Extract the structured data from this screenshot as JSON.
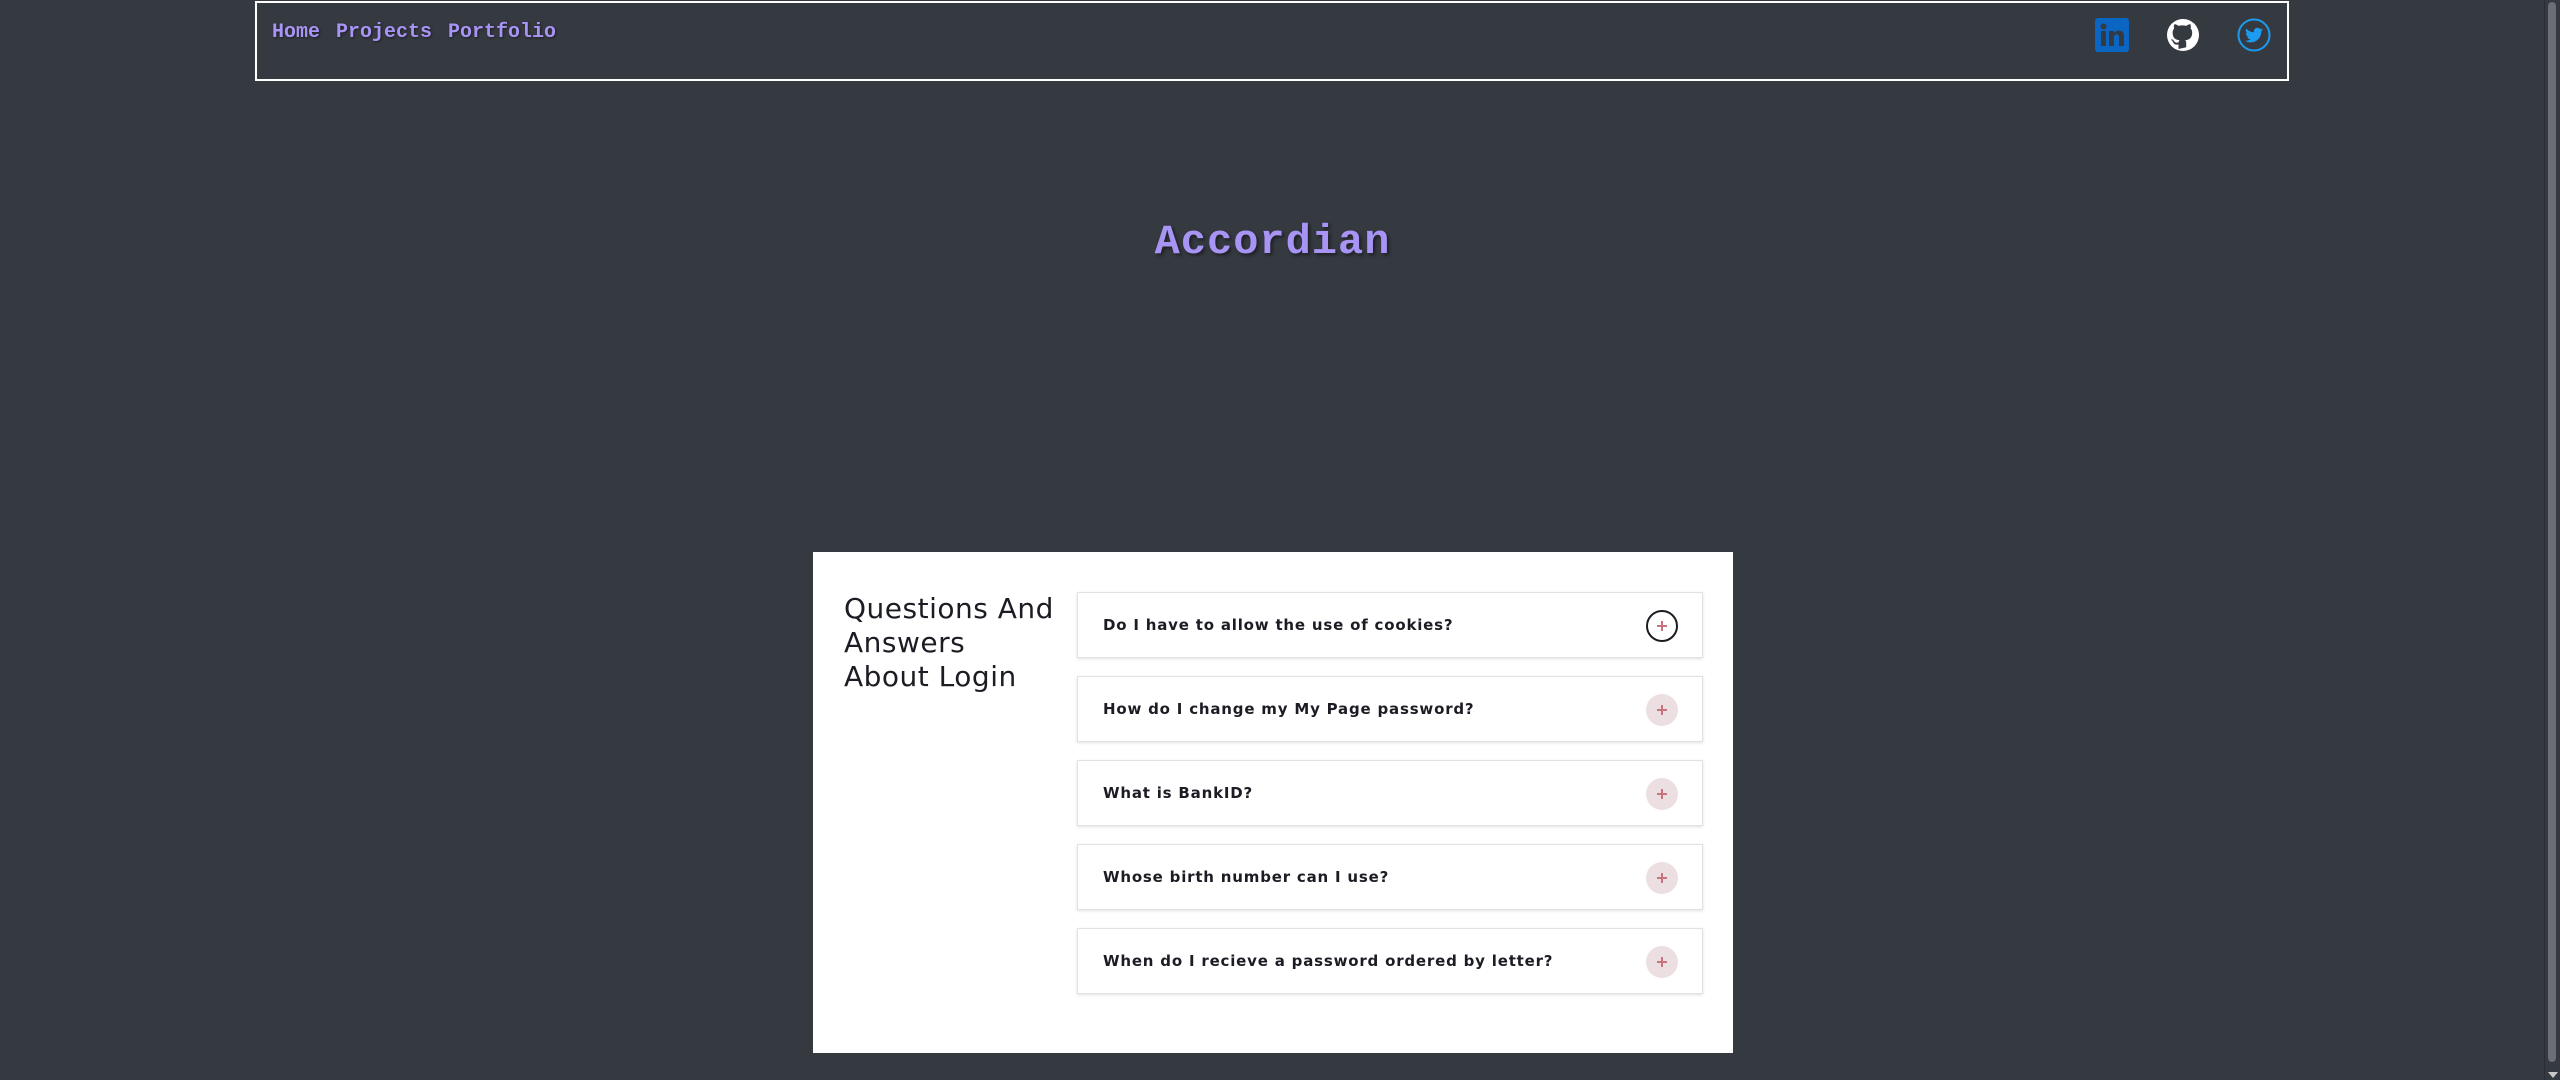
{
  "nav": {
    "links": [
      {
        "label": "Home"
      },
      {
        "label": "Projects"
      },
      {
        "label": "Portfolio"
      }
    ],
    "social": [
      {
        "icon": "linkedin-icon",
        "color": "#0a66c2"
      },
      {
        "icon": "github-icon",
        "color": "#ffffff"
      },
      {
        "icon": "twitter-icon",
        "color": "#1d9bf0"
      }
    ]
  },
  "page": {
    "title": "Accordian"
  },
  "faq": {
    "heading": "Questions And Answers About Login",
    "items": [
      {
        "question": "Do I have to allow the use of cookies?",
        "state": "focused"
      },
      {
        "question": "How do I change my My Page password?",
        "state": "collapsed"
      },
      {
        "question": "What is BankID?",
        "state": "collapsed"
      },
      {
        "question": "Whose birth number can I use?",
        "state": "collapsed"
      },
      {
        "question": "When do I recieve a password ordered by letter?",
        "state": "collapsed"
      }
    ]
  },
  "colors": {
    "background": "#353940",
    "accent": "#a894f4",
    "toggle_bg": "#ecdfe2",
    "toggle_plus": "#c9737f"
  }
}
